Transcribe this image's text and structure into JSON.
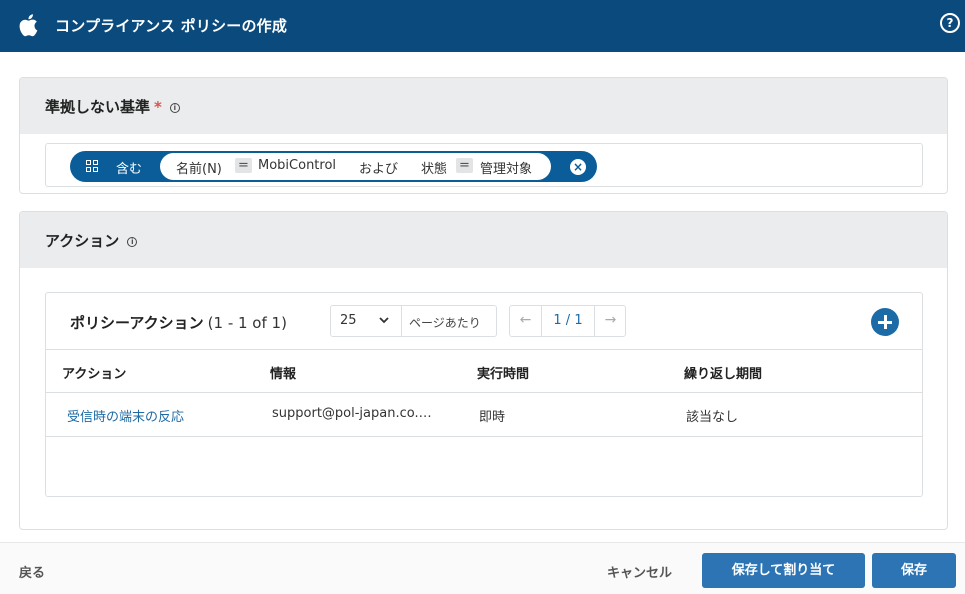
{
  "header": {
    "title": "コンプライアンス ポリシーの作成",
    "logo_icon": "apple-icon",
    "help_icon": "help-icon",
    "help_glyph": "?"
  },
  "noncompliance": {
    "title": "準拠しない基準",
    "required_mark": "*",
    "filter": {
      "mode": "含む",
      "field1": "名前(N)",
      "op1": "=",
      "value1": "MobiControl",
      "conjunction": "および",
      "field2": "状態",
      "op2": "=",
      "value2": "管理対象"
    }
  },
  "actions_section": {
    "title": "アクション",
    "policy_actions": {
      "title": "ポリシーアクション",
      "range": "(1 - 1 of 1)",
      "per_page_value": "25",
      "per_page_label": "ページあたり",
      "page_indicator": "1 / 1",
      "prev_arrow": "←",
      "next_arrow": "→"
    },
    "columns": [
      "アクション",
      "情報",
      "実行時間",
      "繰り返し期間"
    ],
    "rows": [
      [
        "受信時の端末の反応",
        "support@pol-japan.co.…",
        "即時",
        "該当なし"
      ]
    ]
  },
  "footer": {
    "back": "戻る",
    "cancel": "キャンセル",
    "save_assign": "保存して割り当て",
    "save": "保存"
  },
  "colors": {
    "header_bg": "#0b4a7d",
    "pill_bg": "#0b5d99",
    "link": "#1c6aa6",
    "primary_button": "#2c74b3",
    "required": "#d9534f"
  }
}
